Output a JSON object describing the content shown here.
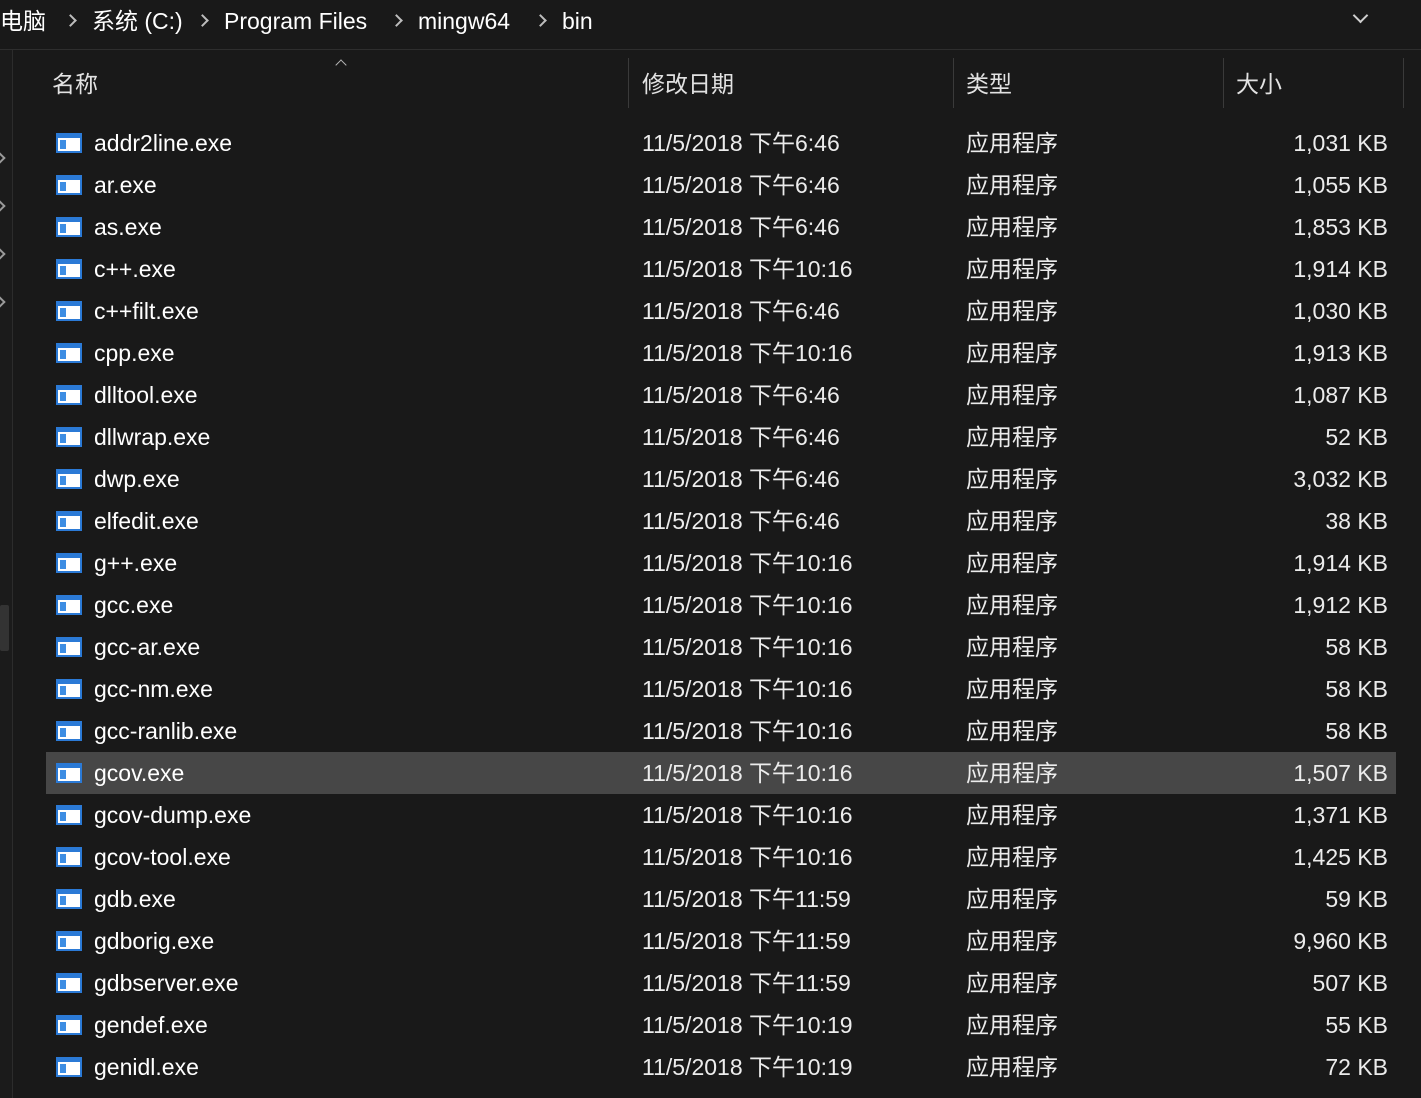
{
  "breadcrumb": {
    "items": [
      "电脑",
      "系统 (C:)",
      "Program Files",
      "mingw64",
      "bin"
    ]
  },
  "columns": {
    "name": "名称",
    "modified": "修改日期",
    "type": "类型",
    "size": "大小",
    "sort_column": "name",
    "sort_direction": "ascending"
  },
  "files": [
    {
      "name": "addr2line.exe",
      "modified": "11/5/2018 下午6:46",
      "type": "应用程序",
      "size": "1,031 KB"
    },
    {
      "name": "ar.exe",
      "modified": "11/5/2018 下午6:46",
      "type": "应用程序",
      "size": "1,055 KB"
    },
    {
      "name": "as.exe",
      "modified": "11/5/2018 下午6:46",
      "type": "应用程序",
      "size": "1,853 KB"
    },
    {
      "name": "c++.exe",
      "modified": "11/5/2018 下午10:16",
      "type": "应用程序",
      "size": "1,914 KB"
    },
    {
      "name": "c++filt.exe",
      "modified": "11/5/2018 下午6:46",
      "type": "应用程序",
      "size": "1,030 KB"
    },
    {
      "name": "cpp.exe",
      "modified": "11/5/2018 下午10:16",
      "type": "应用程序",
      "size": "1,913 KB"
    },
    {
      "name": "dlltool.exe",
      "modified": "11/5/2018 下午6:46",
      "type": "应用程序",
      "size": "1,087 KB"
    },
    {
      "name": "dllwrap.exe",
      "modified": "11/5/2018 下午6:46",
      "type": "应用程序",
      "size": "52 KB"
    },
    {
      "name": "dwp.exe",
      "modified": "11/5/2018 下午6:46",
      "type": "应用程序",
      "size": "3,032 KB"
    },
    {
      "name": "elfedit.exe",
      "modified": "11/5/2018 下午6:46",
      "type": "应用程序",
      "size": "38 KB"
    },
    {
      "name": "g++.exe",
      "modified": "11/5/2018 下午10:16",
      "type": "应用程序",
      "size": "1,914 KB"
    },
    {
      "name": "gcc.exe",
      "modified": "11/5/2018 下午10:16",
      "type": "应用程序",
      "size": "1,912 KB"
    },
    {
      "name": "gcc-ar.exe",
      "modified": "11/5/2018 下午10:16",
      "type": "应用程序",
      "size": "58 KB"
    },
    {
      "name": "gcc-nm.exe",
      "modified": "11/5/2018 下午10:16",
      "type": "应用程序",
      "size": "58 KB"
    },
    {
      "name": "gcc-ranlib.exe",
      "modified": "11/5/2018 下午10:16",
      "type": "应用程序",
      "size": "58 KB"
    },
    {
      "name": "gcov.exe",
      "modified": "11/5/2018 下午10:16",
      "type": "应用程序",
      "size": "1,507 KB",
      "highlighted": true
    },
    {
      "name": "gcov-dump.exe",
      "modified": "11/5/2018 下午10:16",
      "type": "应用程序",
      "size": "1,371 KB"
    },
    {
      "name": "gcov-tool.exe",
      "modified": "11/5/2018 下午10:16",
      "type": "应用程序",
      "size": "1,425 KB"
    },
    {
      "name": "gdb.exe",
      "modified": "11/5/2018 下午11:59",
      "type": "应用程序",
      "size": "59 KB"
    },
    {
      "name": "gdborig.exe",
      "modified": "11/5/2018 下午11:59",
      "type": "应用程序",
      "size": "9,960 KB"
    },
    {
      "name": "gdbserver.exe",
      "modified": "11/5/2018 下午11:59",
      "type": "应用程序",
      "size": "507 KB"
    },
    {
      "name": "gendef.exe",
      "modified": "11/5/2018 下午10:19",
      "type": "应用程序",
      "size": "55 KB"
    },
    {
      "name": "genidl.exe",
      "modified": "11/5/2018 下午10:19",
      "type": "应用程序",
      "size": "72 KB"
    }
  ],
  "icons": {
    "file": "application-icon",
    "breadcrumb_separator": "chevron-right-icon",
    "address_dropdown": "chevron-down-icon",
    "sort": "sort-ascending-icon"
  },
  "colors": {
    "background": "#191919",
    "text": "#ffffff",
    "header_text": "#e2e2e2",
    "row_hover": "#474747",
    "icon_blue": "#2b7ad6"
  }
}
